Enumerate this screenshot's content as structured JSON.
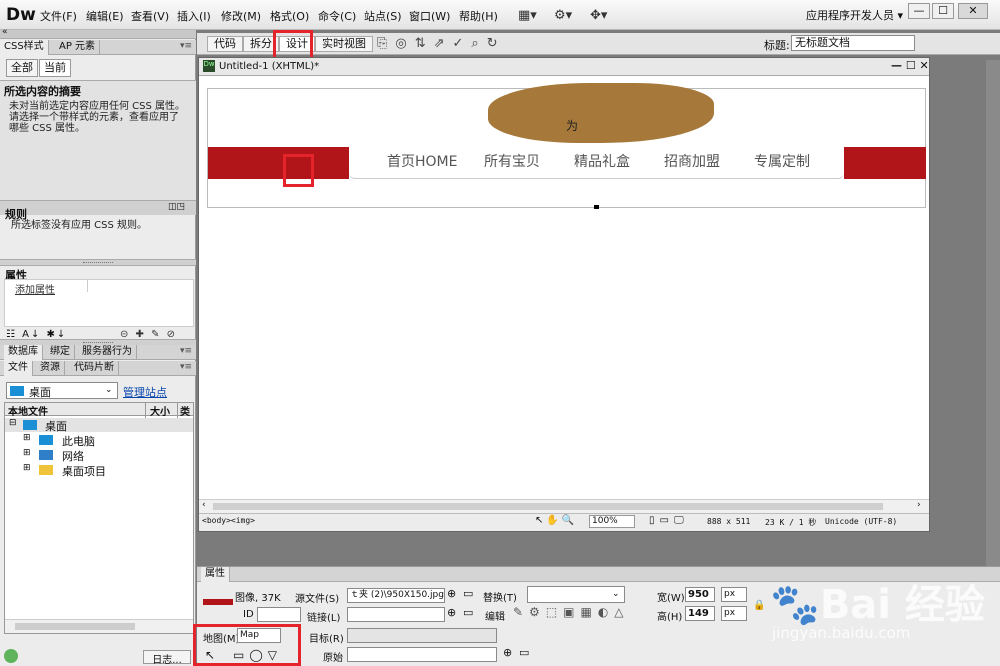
{
  "app": {
    "logo": "Dw",
    "workspace": "应用程序开发人员 ▾",
    "winbtns": [
      "—",
      "☐",
      "✕"
    ]
  },
  "menu": [
    "文件(F)",
    "编辑(E)",
    "查看(V)",
    "插入(I)",
    "修改(M)",
    "格式(O)",
    "命令(C)",
    "站点(S)",
    "窗口(W)",
    "帮助(H)"
  ],
  "toolbar_icons": [
    "▦▾",
    "⚙▾",
    "✥▾"
  ],
  "css_panel": {
    "tabs": [
      "CSS样式",
      "AP 元素"
    ],
    "all": "全部",
    "current": "当前",
    "summary_title": "所选内容的摘要",
    "summary_text": "未对当前选定内容应用任何 CSS 属性。请选择一个带样式的元素，查看应用了哪些 CSS 属性。",
    "rules_title": "规则",
    "rules_text": "所选标签没有应用 CSS 规则。",
    "props_title": "属性",
    "add_prop": "添加属性"
  },
  "files_panel": {
    "tabs1": [
      "数据库",
      "绑定",
      "服务器行为"
    ],
    "tabs2": [
      "文件",
      "资源",
      "代码片断"
    ],
    "location": "桌面",
    "manage": "管理站点",
    "col_local": "本地文件",
    "col_size": "大小",
    "col_type": "类",
    "tree": [
      {
        "label": "桌面",
        "indent": 0
      },
      {
        "label": "此电脑",
        "indent": 1
      },
      {
        "label": "网络",
        "indent": 1
      },
      {
        "label": "桌面项目",
        "indent": 1
      }
    ],
    "log": "日志..."
  },
  "doc_toolbar": {
    "buttons": [
      "代码",
      "拆分",
      "设计",
      "实时视图"
    ],
    "title_label": "标题:",
    "title_value": "无标题文档"
  },
  "document": {
    "tab": "Untitled-1 (XHTML)*",
    "nav": [
      "首页HOME",
      "所有宝贝",
      "精品礼盒",
      "招商加盟",
      "专属定制"
    ],
    "blob_text": "为",
    "status_tags": "<body><img>",
    "zoom": "100%",
    "size": "888 x 511",
    "speed": "23 K / 1 秒",
    "encoding": "Unicode (UTF-8)"
  },
  "properties": {
    "tab": "属性",
    "type": "图像, 37K",
    "src_label": "源文件(S)",
    "src_value": "ｔ夹 (2)\\950X150.jpg",
    "alt_label": "替换(T)",
    "width_label": "宽(W)",
    "width_value": "950",
    "unit": "px",
    "height_label": "高(H)",
    "height_value": "149",
    "id_label": "ID",
    "link_label": "链接(L)",
    "edit_label": "编辑",
    "map_label": "地图(M)",
    "map_value": "Map",
    "target_label": "目标(R)",
    "orig_label": "原始"
  },
  "watermark": {
    "logo": "Bai 经验",
    "url": "jingyan.baidu.com"
  }
}
